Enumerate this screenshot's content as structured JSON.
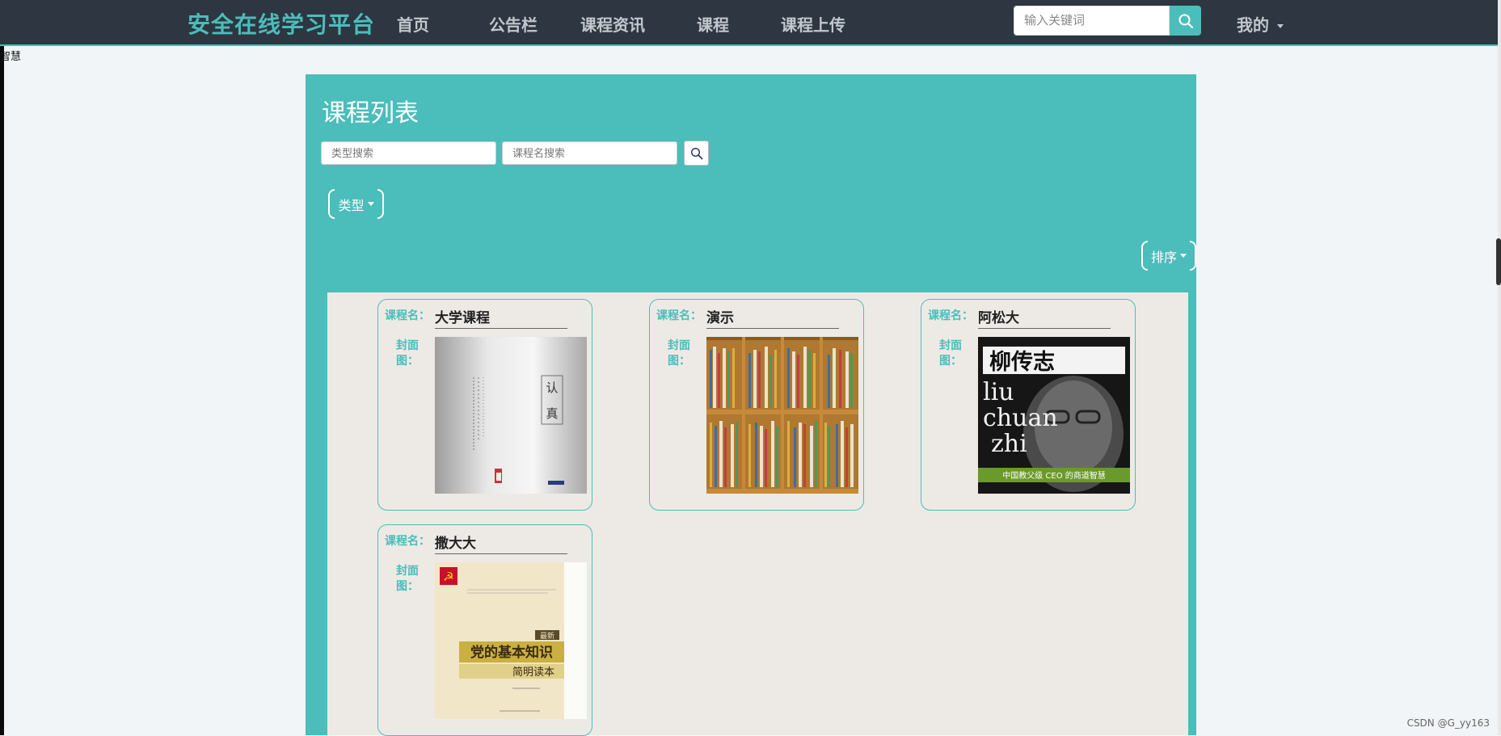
{
  "nav": {
    "brand": "安全在线学习平台",
    "items": [
      "首页",
      "公告栏",
      "课程资讯",
      "课程",
      "课程上传"
    ],
    "search_placeholder": "输入关键词",
    "mine": "我的"
  },
  "overlap_label": "智慧",
  "panel": {
    "title": "课程列表",
    "type_search_placeholder": "类型搜索",
    "name_search_placeholder": "课程名搜索",
    "type_dropdown": "类型",
    "sort_dropdown": "排序"
  },
  "card_labels": {
    "name": "课程名：",
    "cover": "封面图："
  },
  "courses": [
    {
      "name": "大学课程",
      "cover": "book-cover-renzhen-icon"
    },
    {
      "name": "演示",
      "cover": "bookshelf-icon"
    },
    {
      "name": "阿松大",
      "cover": "book-cover-liuchuanzhi-icon"
    },
    {
      "name": "撒大大",
      "cover": "book-cover-party-knowledge-icon"
    }
  ],
  "cover_texts": {
    "renzhen_title": "认真",
    "liu_title": "柳传志",
    "liu_latin_1": "liu",
    "liu_latin_2": "chuan",
    "liu_latin_3": "zhi",
    "liu_subtitle": "中国教父级 CEO 的商道智慧",
    "party_title": "党的基本知识",
    "party_subtitle": "简明读本",
    "party_badge": "最新"
  },
  "watermark": "CSDN @G_yy163"
}
